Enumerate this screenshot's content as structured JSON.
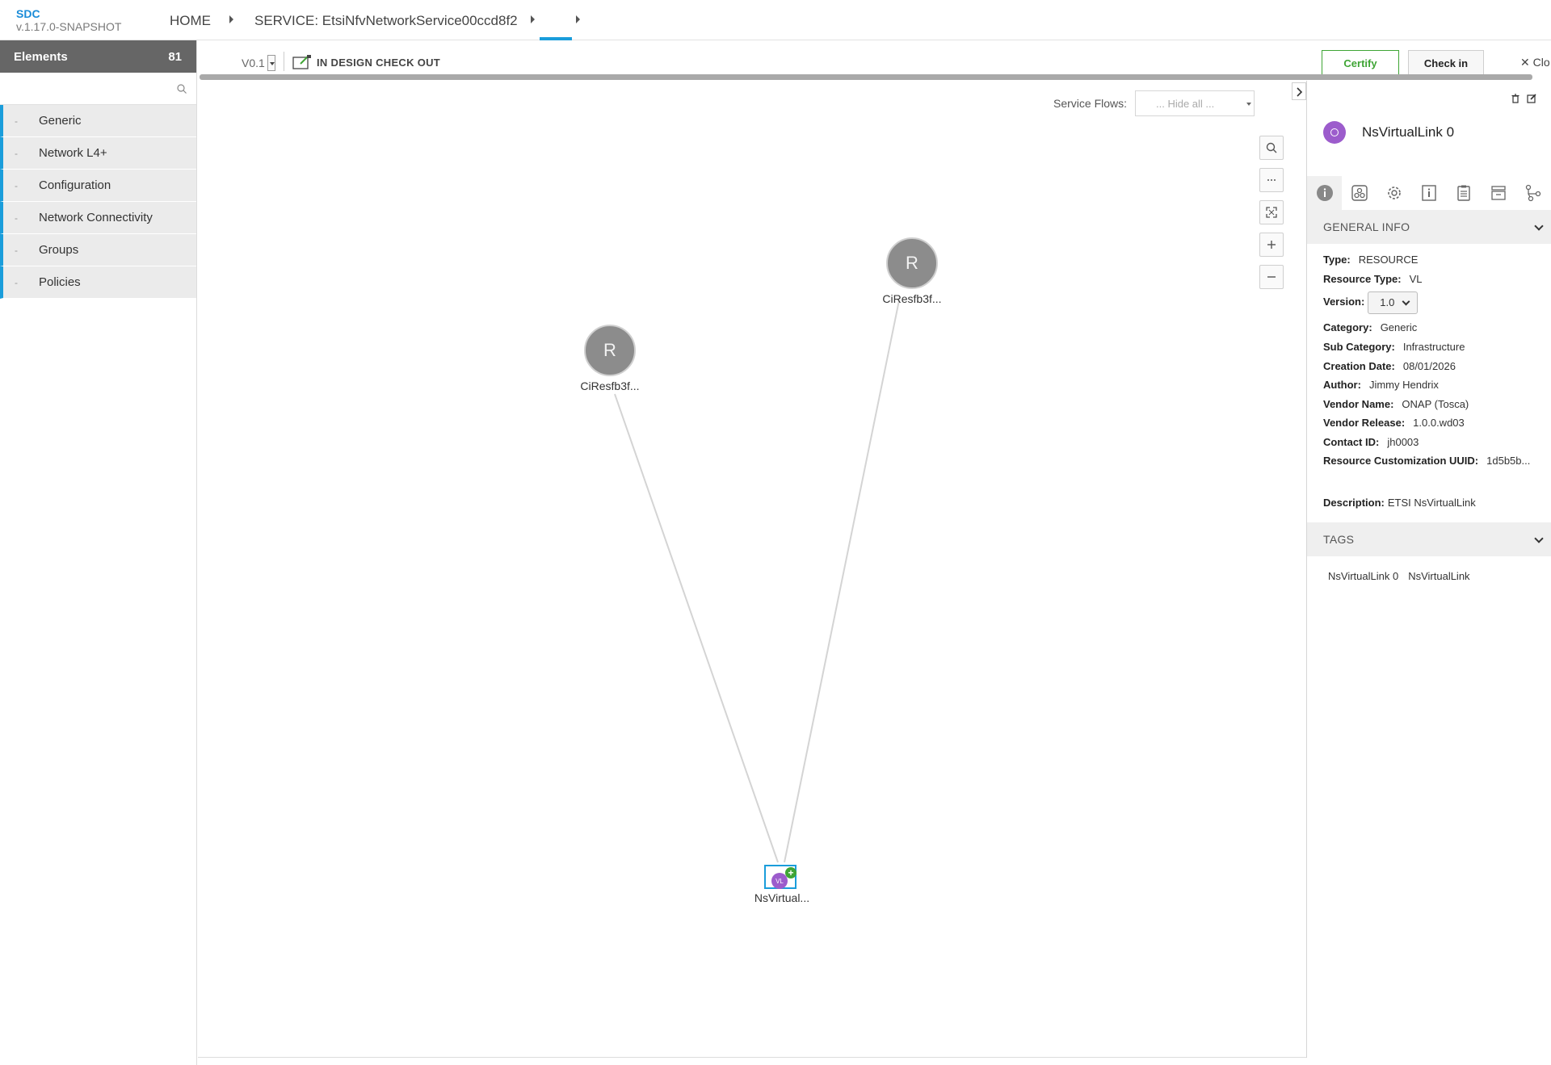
{
  "header": {
    "brand": "SDC",
    "version": "v.1.17.0-SNAPSHOT",
    "breadcrumbs": [
      "HOME",
      "SERVICE: EtsiNfvNetworkService00ccd8f2"
    ]
  },
  "palette": {
    "title": "Elements",
    "count": "81",
    "search_placeholder": "",
    "categories": [
      {
        "dash": "-",
        "label": "Generic"
      },
      {
        "dash": "-",
        "label": "Network L4+"
      },
      {
        "dash": "-",
        "label": "Configuration"
      },
      {
        "dash": "-",
        "label": "Network Connectivity"
      },
      {
        "dash": "-",
        "label": "Groups"
      },
      {
        "dash": "-",
        "label": "Policies"
      }
    ]
  },
  "toolbar": {
    "version": "V0.1",
    "status": "IN DESIGN CHECK OUT",
    "certify_label": "Certify",
    "checkin_label": "Check in",
    "close_label": "Clo"
  },
  "canvas": {
    "service_flows_label": "Service Flows:",
    "service_flows_value": "... Hide all ...",
    "zoom_controls": [
      "search-icon",
      "ellipsis-icon",
      "fit-icon",
      "plus-icon",
      "minus-icon"
    ],
    "nodes": [
      {
        "letter": "R",
        "label": "CiResfb3f..."
      },
      {
        "letter": "R",
        "label": "CiResfb3f..."
      }
    ],
    "vl_node": {
      "badge": "VL",
      "label": "NsVirtual..."
    }
  },
  "panel": {
    "title": "NsVirtualLink 0",
    "general_info_title": "GENERAL INFO",
    "info": [
      {
        "k": "Type:",
        "v": "RESOURCE"
      },
      {
        "k": "Resource Type:",
        "v": "VL"
      },
      {
        "k": "Version:",
        "v": "1.0"
      },
      {
        "k": "Category:",
        "v": "Generic"
      },
      {
        "k": "Sub Category:",
        "v": "Infrastructure"
      },
      {
        "k": "Creation Date:",
        "v": "08/01/2026"
      },
      {
        "k": "Author:",
        "v": "Jimmy Hendrix"
      },
      {
        "k": "Vendor Name:",
        "v": "ONAP (Tosca)"
      },
      {
        "k": "Vendor Release:",
        "v": "1.0.0.wd03"
      },
      {
        "k": "Contact ID:",
        "v": "jh0003"
      },
      {
        "k": "Resource Customization UUID:",
        "v": "1d5b5b..."
      },
      {
        "k": "Description:",
        "v": "ETSI NsVirtualLink"
      }
    ],
    "tags_title": "TAGS",
    "tags": [
      "NsVirtualLink 0",
      "NsVirtualLink"
    ]
  },
  "colors": {
    "accent": "#1a9ddb",
    "certify": "#3fa535",
    "vl_purple": "#9c5ccc",
    "node_gray": "#8c8c8c"
  }
}
